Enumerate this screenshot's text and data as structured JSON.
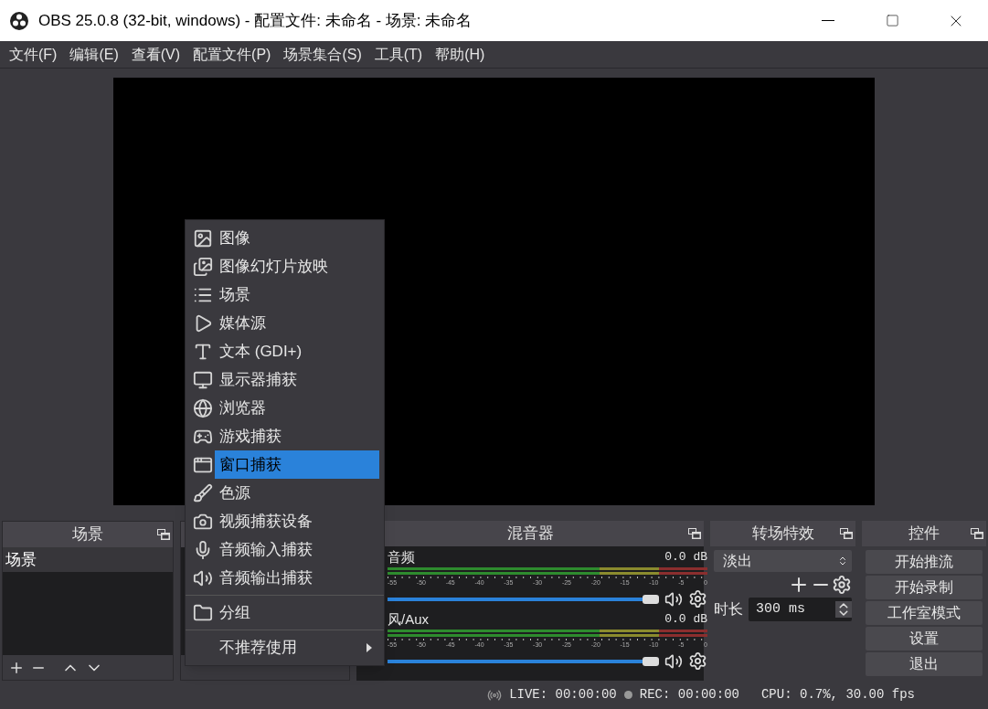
{
  "window": {
    "title": "OBS 25.0.8 (32-bit, windows) - 配置文件: 未命名 - 场景: 未命名"
  },
  "menu_bar": [
    "文件(F)",
    "编辑(E)",
    "查看(V)",
    "配置文件(P)",
    "场景集合(S)",
    "工具(T)",
    "帮助(H)"
  ],
  "scenes": {
    "title": "场景",
    "items": [
      {
        "label": "场景",
        "selected": true
      }
    ]
  },
  "mixer": {
    "title": "混音器",
    "channels": [
      {
        "name": "音频",
        "reading": "0.0 dB",
        "level": 1,
        "muted": false,
        "ticks": [
          "-55",
          "-50",
          "-45",
          "-40",
          "-35",
          "-30",
          "-25",
          "-20",
          "-15",
          "-10",
          "-5",
          "0"
        ]
      },
      {
        "name": "风/Aux",
        "reading": "0.0 dB",
        "level": 1,
        "muted": false,
        "ticks": [
          "-55",
          "-50",
          "-45",
          "-40",
          "-35",
          "-30",
          "-25",
          "-20",
          "-15",
          "-10",
          "-5",
          "0"
        ]
      }
    ]
  },
  "transitions": {
    "title": "转场特效",
    "selected": "淡出",
    "duration_label": "时长",
    "duration": "300 ms"
  },
  "controls": {
    "title": "控件",
    "buttons": [
      "开始推流",
      "开始录制",
      "工作室模式",
      "设置",
      "退出"
    ]
  },
  "add_source_menu": {
    "sections": [
      {
        "items": [
          {
            "kind": "image",
            "label": "图像",
            "selected": false
          },
          {
            "kind": "slideshow",
            "label": "图像幻灯片放映",
            "selected": false
          },
          {
            "kind": "scene",
            "label": "场景",
            "selected": false
          },
          {
            "kind": "media",
            "label": "媒体源",
            "selected": false
          },
          {
            "kind": "text",
            "label": "文本 (GDI+)",
            "selected": false
          },
          {
            "kind": "display",
            "label": "显示器捕获",
            "selected": false
          },
          {
            "kind": "browser",
            "label": "浏览器",
            "selected": false
          },
          {
            "kind": "game",
            "label": "游戏捕获",
            "selected": false
          },
          {
            "kind": "window",
            "label": "窗口捕获",
            "selected": true
          },
          {
            "kind": "color",
            "label": "色源",
            "selected": false
          },
          {
            "kind": "video",
            "label": "视频捕获设备",
            "selected": false
          },
          {
            "kind": "audio-in",
            "label": "音频输入捕获",
            "selected": false
          },
          {
            "kind": "audio-out",
            "label": "音频输出捕获",
            "selected": false
          }
        ]
      },
      {
        "items": [
          {
            "kind": "group",
            "label": "分组",
            "selected": false
          }
        ]
      },
      {
        "items": [
          {
            "kind": "submenu",
            "label": "不推荐使用",
            "selected": false
          }
        ]
      }
    ]
  },
  "status_bar": {
    "live": "LIVE: 00:00:00",
    "rec": "REC: 00:00:00",
    "cpu": "CPU: 0.7%, 30.00 fps"
  }
}
